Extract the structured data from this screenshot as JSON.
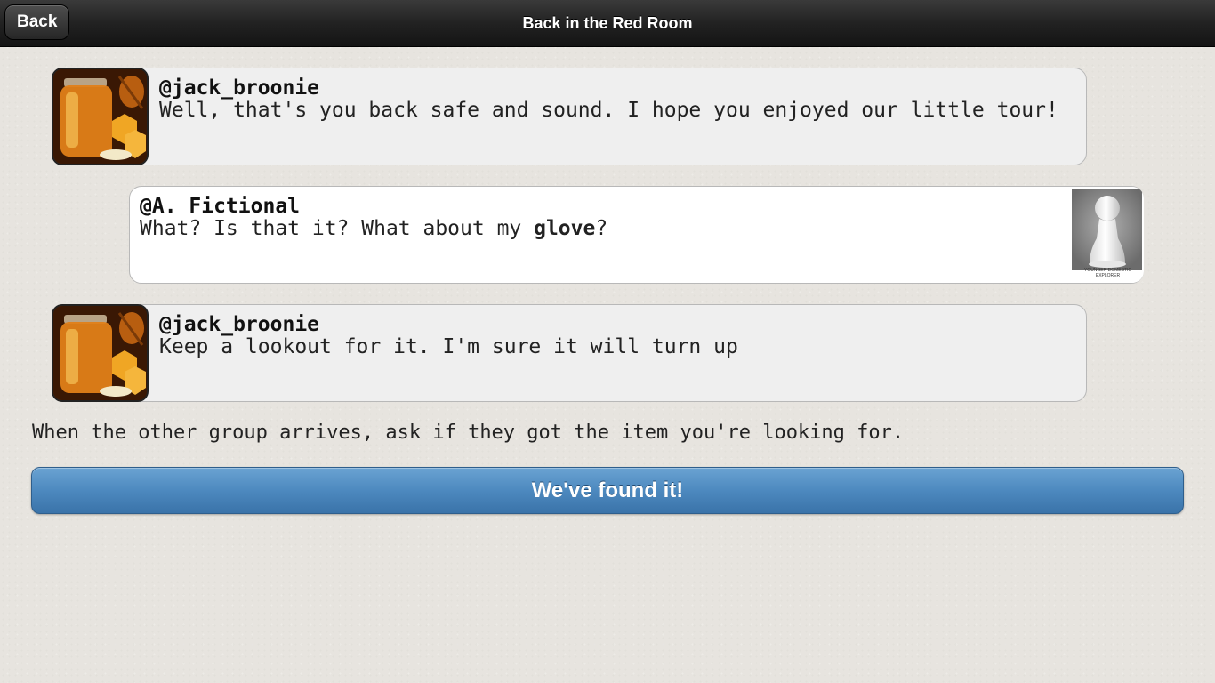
{
  "header": {
    "back_label": "Back",
    "title": "Back in the Red Room"
  },
  "messages": [
    {
      "author": "@jack_broonie",
      "text": "Well, that's you back safe and sound. I hope you enjoyed our little tour!",
      "avatar_icon": "honey-jar-avatar"
    },
    {
      "author": "@A. Fictional",
      "text_before": "What? Is that it? What about my ",
      "text_bold": "glove",
      "text_after": "?",
      "avatar_icon": "white-pawn-avatar",
      "avatar_caption": "YOUNGER DOMESTIC EXPLORER"
    },
    {
      "author": "@jack_broonie",
      "text": "Keep a lookout for it. I'm sure it will turn up",
      "avatar_icon": "honey-jar-avatar"
    }
  ],
  "instruction": "When the other group arrives, ask if they got the item you're looking for.",
  "action_button": "We've found it!",
  "colors": {
    "header_bg": "#1c1c1c",
    "button_blue": "#4d89bf",
    "page_bg": "#e7e4df"
  }
}
